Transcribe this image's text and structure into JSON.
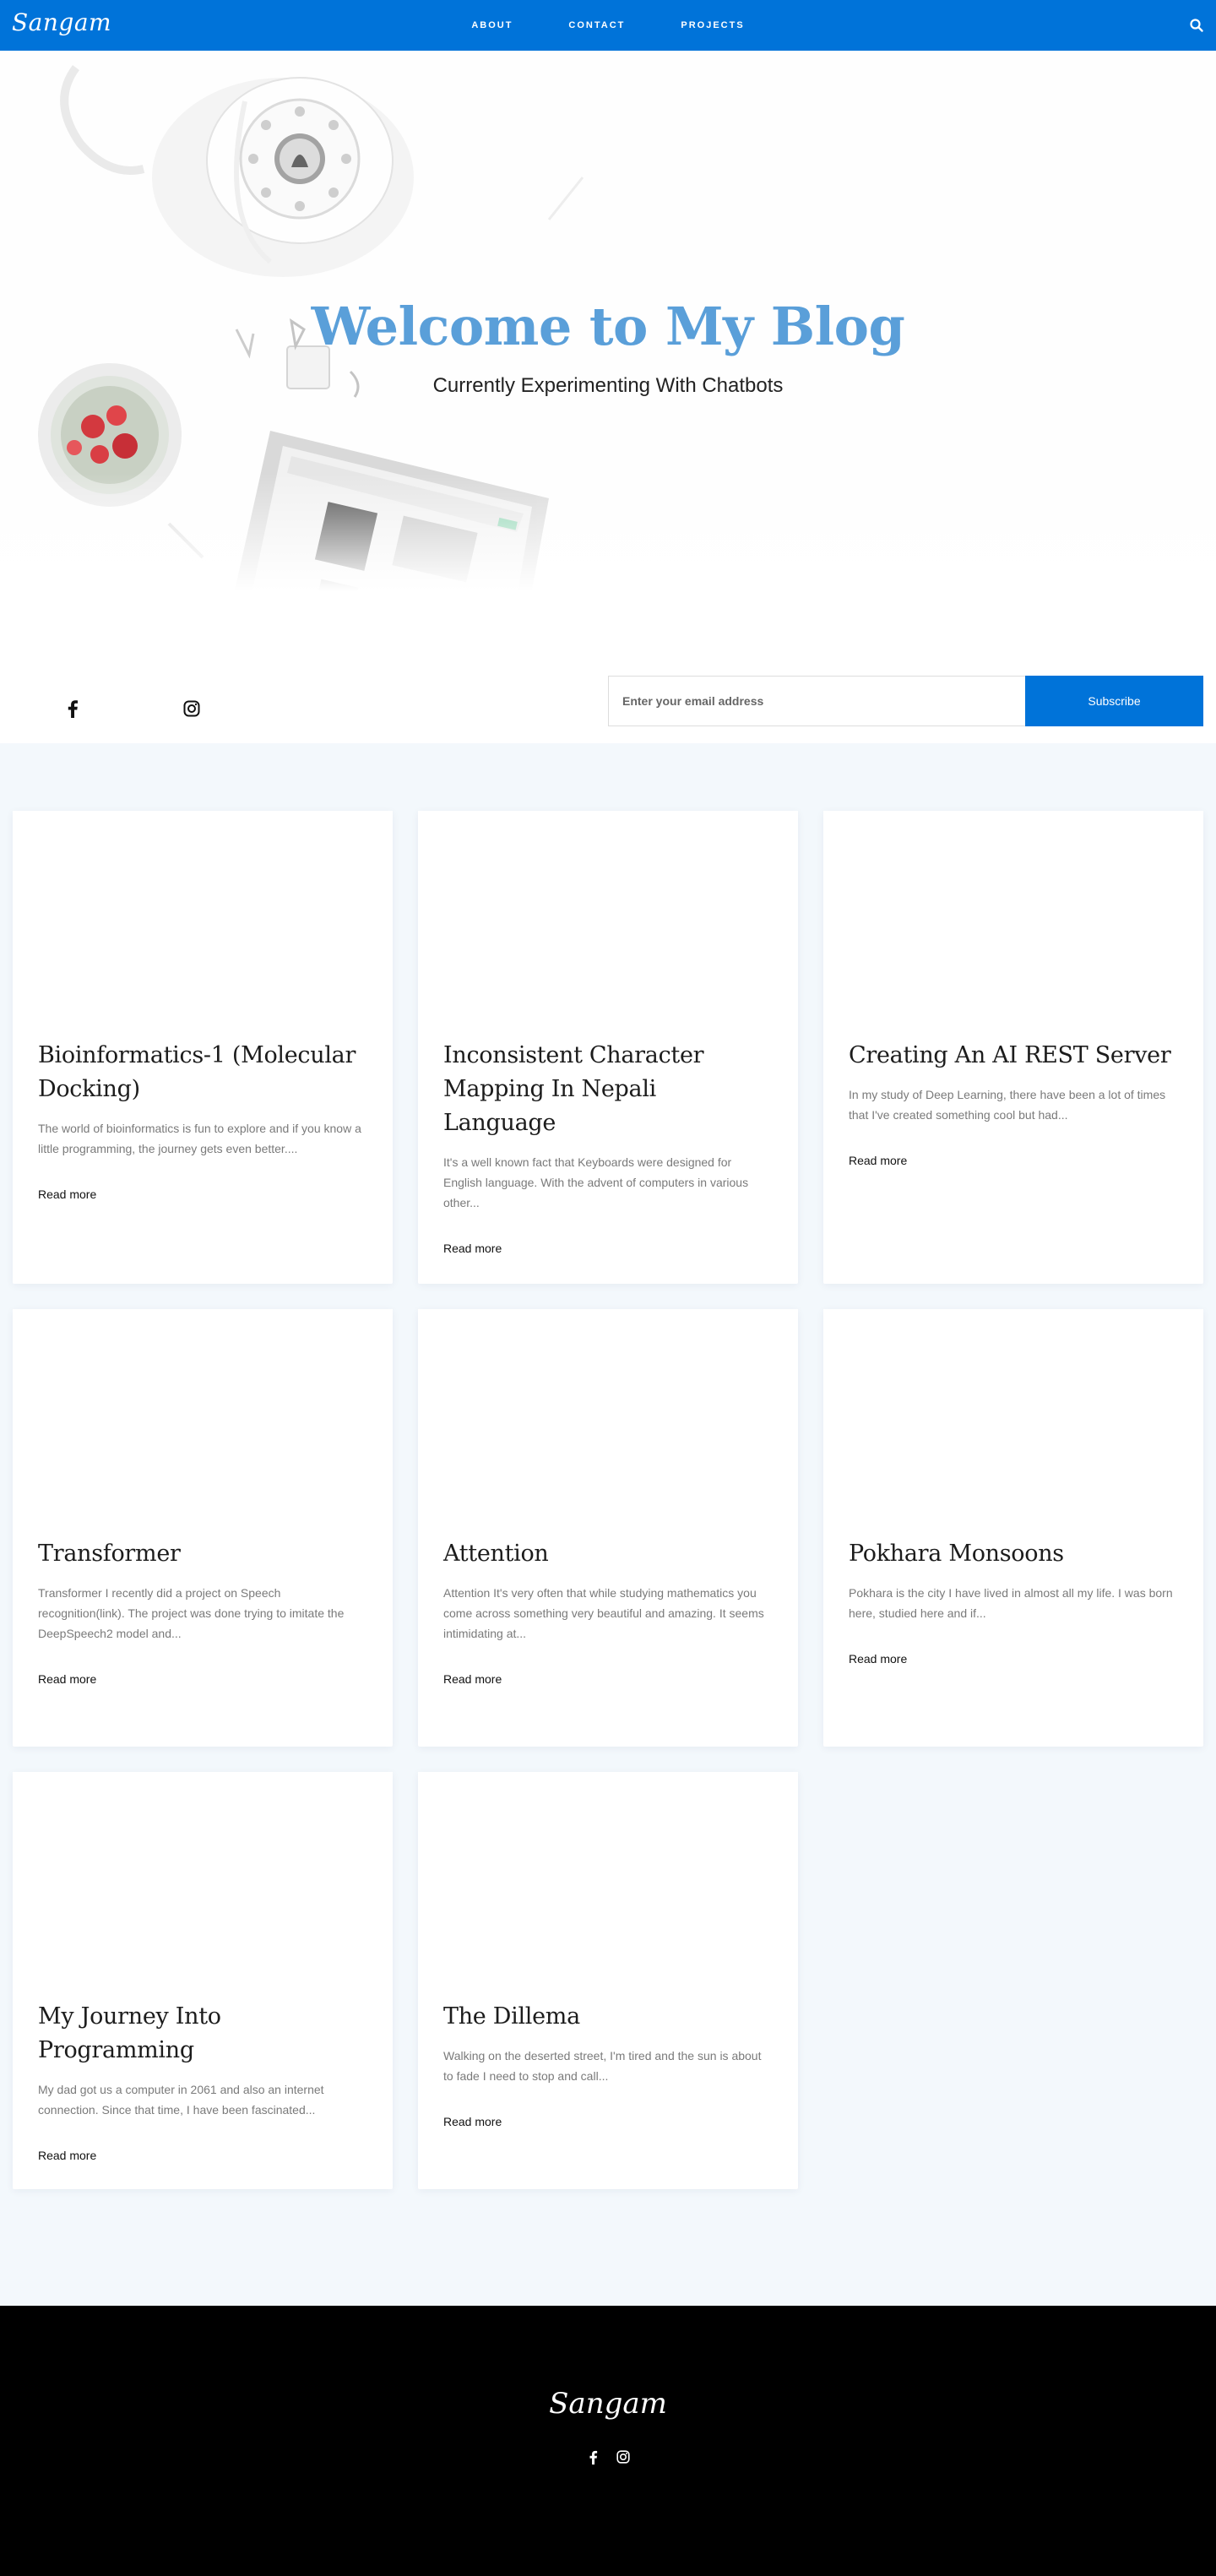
{
  "nav": {
    "brand": "Sangam",
    "links": [
      "ABOUT",
      "CONTACT",
      "PROJECTS"
    ],
    "search_icon": "search-icon"
  },
  "hero": {
    "title": "Welcome to My Blog",
    "subtitle": "Currently Experimenting With Chatbots"
  },
  "social": {
    "icons": [
      "facebook-icon",
      "instagram-icon"
    ]
  },
  "subscribe": {
    "placeholder": "Enter your email address",
    "button_label": "Subscribe"
  },
  "posts": [
    {
      "title": "Bioinformatics-1 (Molecular Docking)",
      "excerpt": "The world of bioinformatics is fun to explore and if you know a little programming, the journey gets even better....",
      "link": "Read more"
    },
    {
      "title": "Inconsistent Character Mapping In Nepali Language",
      "excerpt": "It's a well known fact that Keyboards were designed for English language. With the advent of computers in various other...",
      "link": "Read more"
    },
    {
      "title": "Creating An AI REST Server",
      "excerpt": "In my study of Deep Learning, there have been a lot of times that I've created something cool but had...",
      "link": "Read more"
    },
    {
      "title": "Transformer",
      "excerpt": "Transformer  I recently did a project on Speech recognition(link). The project was done trying to imitate the DeepSpeech2 model and...",
      "link": "Read more"
    },
    {
      "title": "Attention",
      "excerpt": "Attention It's very often that while studying mathematics you come across something very beautiful and amazing. It seems intimidating at...",
      "link": "Read more"
    },
    {
      "title": "Pokhara Monsoons",
      "excerpt": "Pokhara is the city I have lived in almost all my life. I was born here, studied here and if...",
      "link": "Read more"
    },
    {
      "title": "My Journey Into Programming",
      "excerpt": "My dad got us a computer in 2061 and also an internet connection. Since that time, I have been fascinated...",
      "link": "Read more"
    },
    {
      "title": "The Dillema",
      "excerpt": "Walking on the deserted street, I'm tired and the sun is about to fade I need to stop and call...",
      "link": "Read more"
    }
  ],
  "footer": {
    "brand": "Sangam",
    "icons": [
      "facebook-icon",
      "instagram-icon"
    ]
  },
  "colors": {
    "primary": "#0073d9",
    "hero_title": "#5a9fd9",
    "posts_bg": "#f3f8fc",
    "footer_bg": "#000000"
  }
}
